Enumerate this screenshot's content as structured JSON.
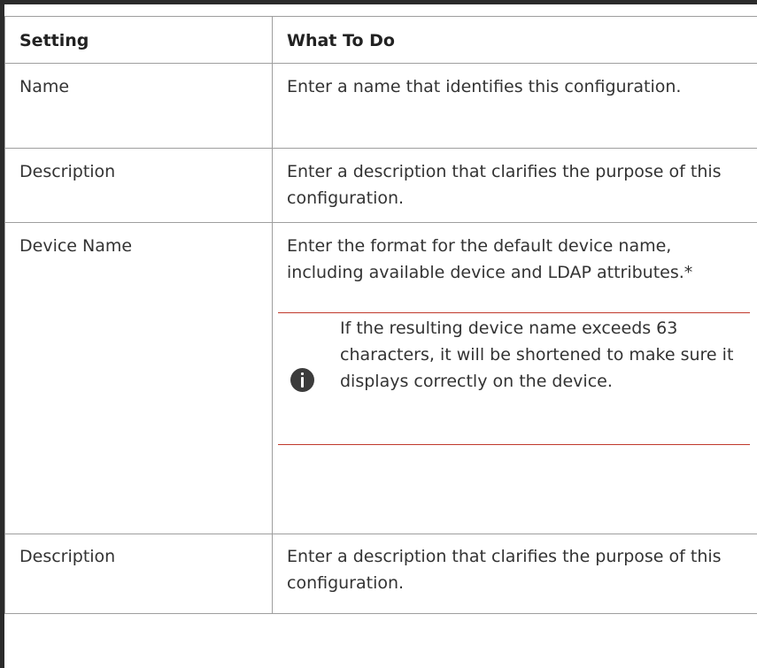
{
  "table": {
    "headers": {
      "setting": "Setting",
      "what_to_do": "What To Do"
    },
    "rows": [
      {
        "setting": "Name",
        "what_to_do": "Enter a name that identifies this configuration."
      },
      {
        "setting": "Description",
        "what_to_do": "Enter a description that clarifies the purpose of this configuration."
      },
      {
        "setting": "Device Name",
        "what_to_do": "Enter the format for the default device name, including available device and LDAP attributes.*",
        "note": {
          "icon": "info-icon",
          "text": "If the resulting device name exceeds 63 characters, it will be shortened to make sure it displays correctly on the device."
        }
      },
      {
        "setting": "Description",
        "what_to_do": "Enter a description that clarifies the purpose of this configuration."
      }
    ]
  },
  "colors": {
    "border": "#9e9e9e",
    "note_rule": "#c0392b",
    "frame": "#2b2b2b",
    "icon": "#3c3c3c"
  }
}
